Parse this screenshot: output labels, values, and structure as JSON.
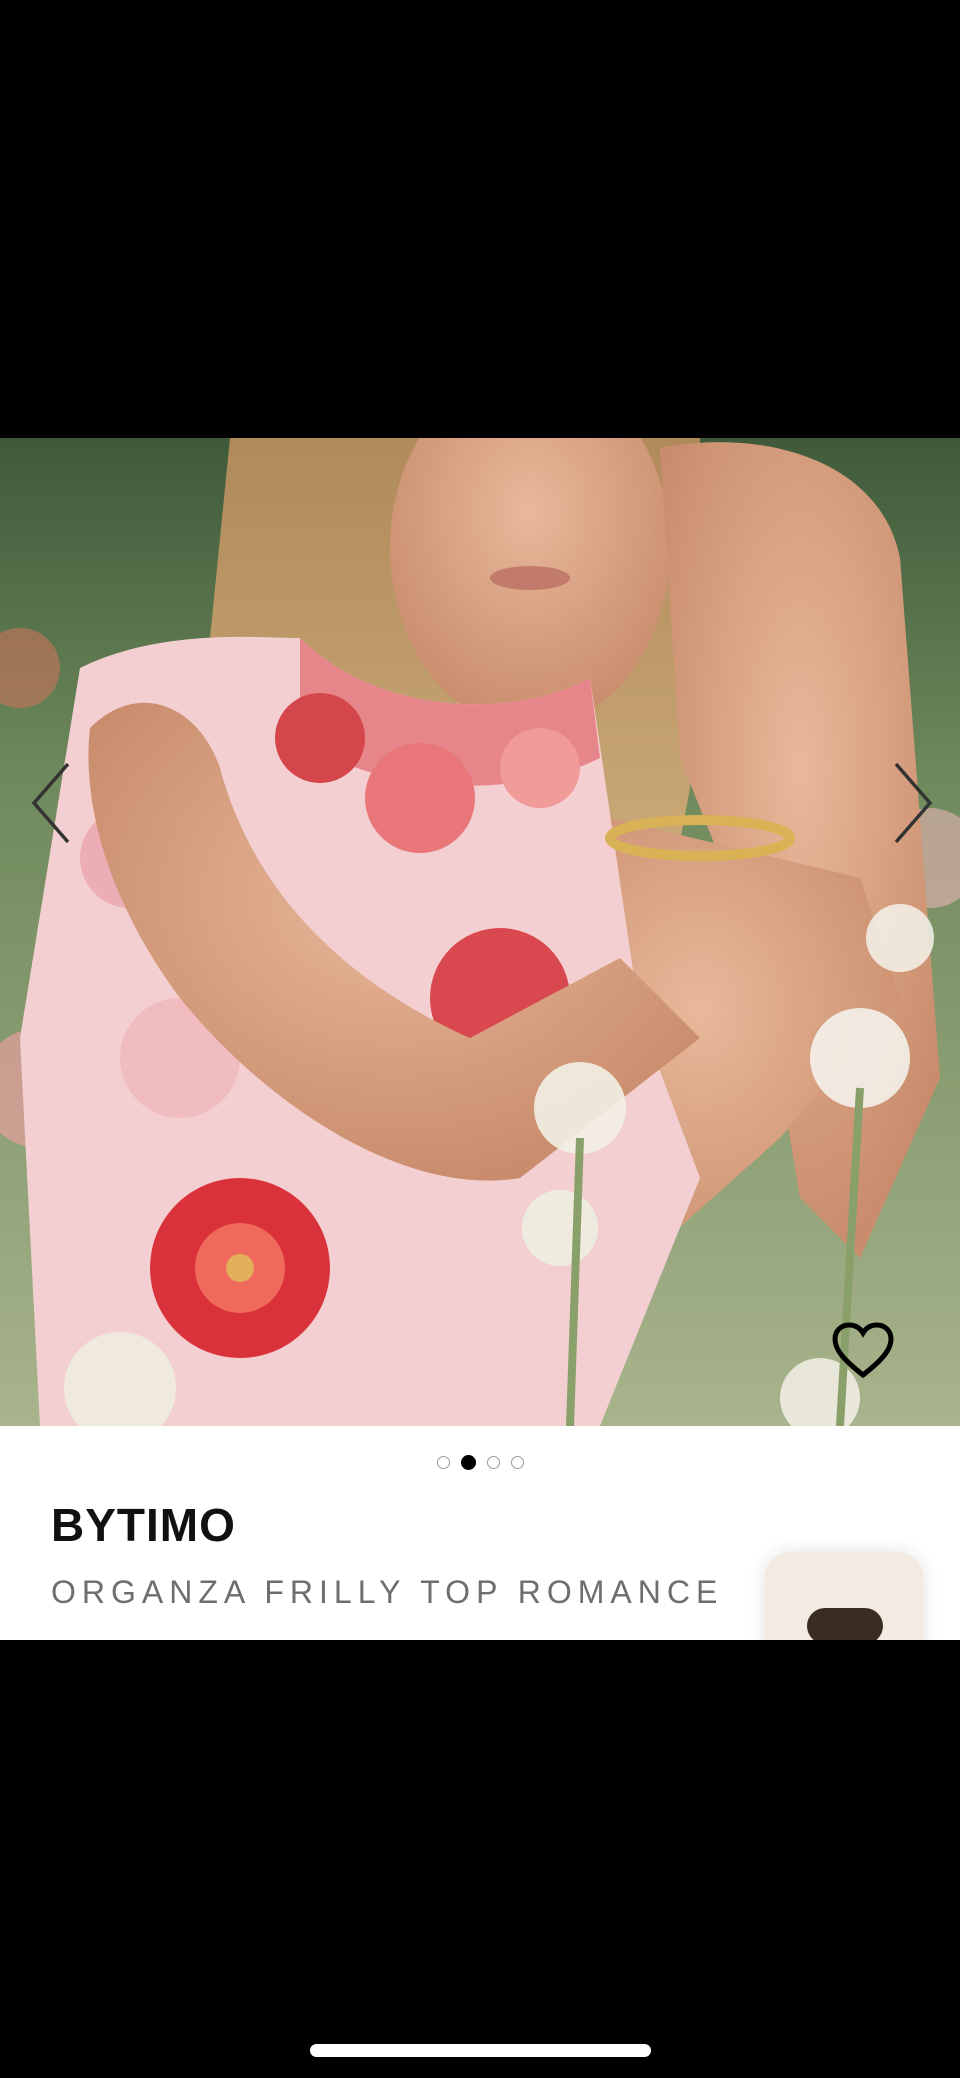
{
  "product": {
    "brand": "BYTIMO",
    "name": "ORGANZA FRILLY TOP ROMANCE"
  },
  "gallery": {
    "image_count": 4,
    "active_index": 1,
    "image_description_icon": "product-photo"
  },
  "icons": {
    "prev": "chevron-left-icon",
    "next": "chevron-right-icon",
    "favorite": "heart-outline-icon",
    "chat": "chat-bubble-icon"
  },
  "colors": {
    "background": "#000000",
    "card": "#ffffff",
    "brand_text": "#111111",
    "product_text": "#6e6e6e",
    "active_dot": "#000000",
    "chat_fab": "#f3ebe1",
    "chat_pill": "#3b2c22"
  }
}
